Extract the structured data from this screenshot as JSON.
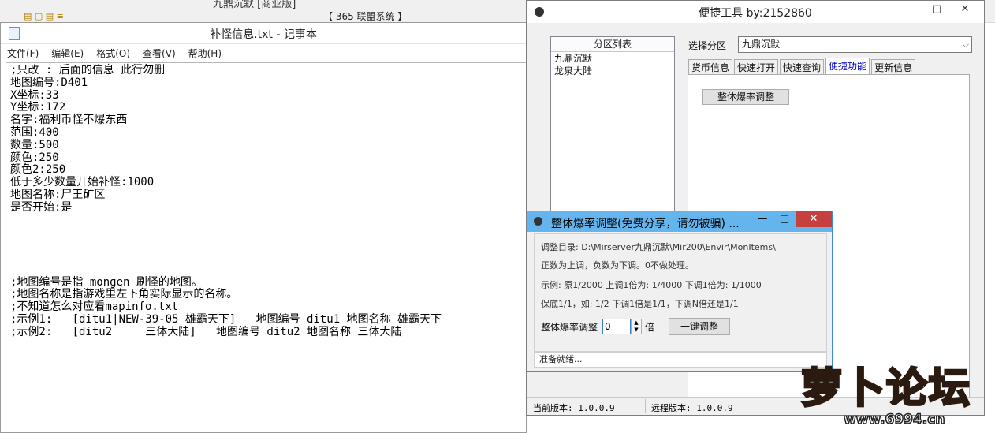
{
  "background": {
    "title1": "九鼎沉默 [商业版]",
    "title2": "【 365 联盟系统 】"
  },
  "notepad": {
    "title": "补怪信息.txt - 记事本",
    "menu": [
      "文件(F)",
      "编辑(E)",
      "格式(O)",
      "查看(V)",
      "帮助(H)"
    ],
    "lines": [
      ";只改 : 后面的信息 此行勿删",
      "地图编号:D401",
      "X坐标:33",
      "Y坐标:172",
      "名字:福利币怪不爆东西",
      "范围:400",
      "数量:500",
      "颜色:250",
      "颜色2:250",
      "低于多少数量开始补怪:1000",
      "地图名称:尸王矿区",
      "是否开始:是",
      "",
      "",
      "",
      "",
      "",
      ";地图编号是指 mongen 刷怪的地图。",
      ";地图名称是指游戏里左下角实际显示的名称。",
      ";不知道怎么对应看mapinfo.txt",
      ";示例1:   [ditu1|NEW-39-05 雄霸天下]   地图编号 ditu1 地图名称 雄霸天下",
      ";示例2:   [ditu2     三体大陆]   地图编号 ditu2 地图名称 三体大陆"
    ]
  },
  "tool": {
    "title": "便捷工具 by:2152860",
    "window_buttons": {
      "minimize": "—",
      "maximize": "□",
      "close": "✕"
    },
    "region_list": {
      "header": "分区列表",
      "items": [
        "九鼎沉默",
        "龙泉大陆"
      ]
    },
    "select_label": "选择分区",
    "select_value": "九鼎沉默",
    "tabs": [
      "货币信息",
      "快速打开",
      "快速查询",
      "便捷功能",
      "更新信息"
    ],
    "active_tab": "便捷功能",
    "overall_button": "整体爆率调整",
    "status": {
      "current": "当前版本: 1.0.0.9",
      "remote": "远程版本: 1.0.0.9"
    }
  },
  "dialog": {
    "title": "整体爆率调整(免费分享，请勿被骗) ...",
    "window_buttons": {
      "minimize": "—",
      "maximize": "□",
      "close": "✕"
    },
    "dir_text": "调整目录: D:\\Mirserver九鼎沉默\\Mir200\\Envir\\MonItems\\",
    "rule_text": "正数为上调，负数为下调。0不做处理。",
    "example_text": "示例: 原1/2000 上调1倍为: 1/4000 下调1倍为: 1/1000",
    "keep_text": "保底1/1，如: 1/2 下调1倍是1/1，下调N倍还是1/1",
    "adjust_label": "整体爆率调整",
    "spin_value": "0",
    "multiplier_unit": "倍",
    "onekey_button": "一键调整",
    "status": "准备就绪..."
  },
  "watermark": {
    "logo": "萝卜论坛",
    "url": "www.6994.cn"
  }
}
